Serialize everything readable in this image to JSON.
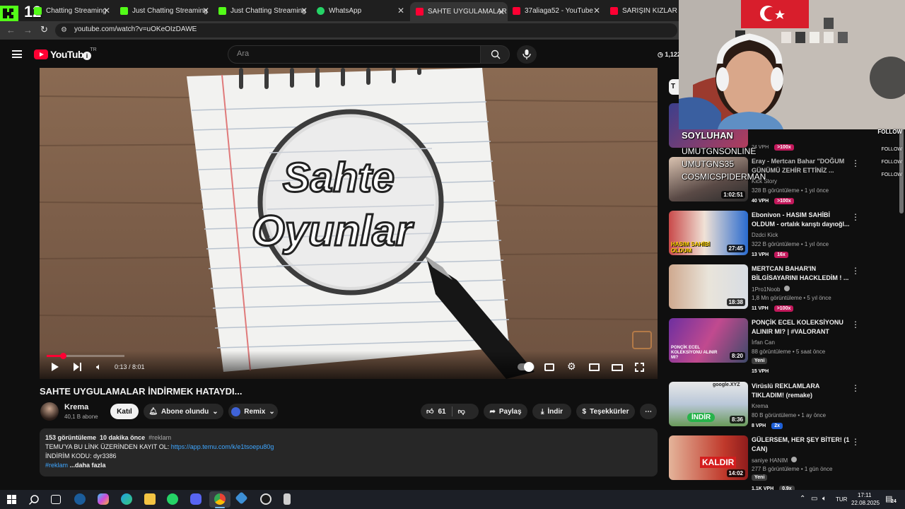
{
  "browser": {
    "tabs": [
      {
        "label": "Chatting Streaming",
        "icon": "kick-icon",
        "color": "#53fc18"
      },
      {
        "label": "Just Chatting Streaming",
        "icon": "kick-icon",
        "color": "#53fc18"
      },
      {
        "label": "Just Chatting Streaming",
        "icon": "kick-icon",
        "color": "#53fc18"
      },
      {
        "label": "WhatsApp",
        "icon": "whatsapp-icon",
        "color": "#25d366"
      },
      {
        "label": "SAHTE UYGULAMALAR İN",
        "icon": "youtube-icon",
        "color": "#ff0033"
      },
      {
        "label": "37aliaga52 - YouTube",
        "icon": "youtube-icon",
        "color": "#ff0033"
      },
      {
        "label": "SARIŞIN KIZLAR | RAP A",
        "icon": "youtube-icon",
        "color": "#ff0033"
      }
    ],
    "url": "youtube.com/watch?v=uOKeOIzDAWE"
  },
  "kick_overlay": {
    "number": "12"
  },
  "youtube": {
    "logo_text": "YouTube",
    "region": "TR",
    "search_placeholder": "Ara",
    "counter": "1,122"
  },
  "video": {
    "thumbnail_word1": "Sahte",
    "thumbnail_word2": "Oyunlar",
    "time_current": "0:13",
    "time_total": "8:01",
    "progress": 0.027,
    "title": "SAHTE UYGULAMALAR İNDİRMEK HATAYDI...",
    "channel": "Krema",
    "subscribers": "40,1 B abone",
    "join": "Katıl",
    "subscribed": "Abone olundu",
    "remix": "Remix",
    "likes": "61",
    "share": "Paylaş",
    "download": "İndir",
    "thanks": "Teşekkürler",
    "description": {
      "views": "153 görüntüleme",
      "time": "10 dakika önce",
      "tag": "#reklam",
      "line1_prefix": "TEMU'YA BU LİNK ÜZERİNDEN KAYIT OL:",
      "line1_link": "https://app.temu.com/k/e1tsoepu80g",
      "line2": "İNDİRİM KODU: dyr3386",
      "line3_tag": "#reklam",
      "more": "...daha fazla"
    }
  },
  "sidebar": {
    "filter_label": "T",
    "items": [
      {
        "title": "",
        "channel": "",
        "meta": "24 VPH",
        "duration": "",
        "vph": "",
        "badge": ">100x",
        "badge_color": "#c2185b"
      },
      {
        "title": "Eray - Mertcan Bahar \"DOĞUM GÜNÜMÜ ZEHİR ETTİNİZ ...",
        "channel": "Kick Story",
        "meta": "328 B görüntüleme • 1 yıl önce",
        "duration": "1:02:51",
        "vph": "40 VPH",
        "badge": ">100x",
        "badge_color": "#c2185b"
      },
      {
        "title": "Ebonivon - HASIM SAHİBİ OLDUM - ortalık karıştı dayıoğl...",
        "channel": "Dzdci Kick",
        "meta": "322 B görüntüleme • 1 yıl önce",
        "duration": "27:45",
        "vph": "13 VPH",
        "badge": "16x",
        "badge_color": "#c2185b"
      },
      {
        "title": "MERTCAN BAHAR'IN BİLGİSAYARINI HACKLEDİM ! ...",
        "channel": "1Pro1Noob",
        "meta": "1,8 Mn görüntüleme • 5 yıl önce",
        "duration": "18:38",
        "vph": "11 VPH",
        "badge": ">100x",
        "badge_color": "#c2185b"
      },
      {
        "title": "PONÇİK ECEL KOLEKSİYONU ALINIR MI? | #VALORANT",
        "channel": "İrfan Can",
        "meta": "88 görüntüleme • 5 saat önce",
        "duration": "8:20",
        "vph": "15 VPH",
        "badge": "Yeni",
        "badge_color": "#3f3f3f"
      },
      {
        "title": "Virüslü REKLAMLARA TIKLADIM! (remake)",
        "channel": "Krema",
        "meta": "80 B görüntüleme • 1 ay önce",
        "duration": "8:36",
        "vph": "8 VPH",
        "badge": "2x",
        "badge_color": "#1e5fd6"
      },
      {
        "title": "GÜLERSEM, HER ŞEY BİTER! (1 CAN)",
        "channel": "saniye HANIM",
        "meta": "277 B görüntüleme • 1 gün önce",
        "duration": "14:02",
        "vph": "1,1K VPH",
        "badge": "0,9x",
        "badge_color": "#3f3f3f"
      }
    ],
    "thumb_texts": {
      "hasim": "HASIM SAHİBİ OLDUM",
      "indir": "İNDİR",
      "kaldir": "KALDIR",
      "ponchik": "PONÇİK ECEL KOLEKSİYONU ALINIR MI?",
      "gsite": "google.XYZ"
    }
  },
  "stream_overlay": {
    "names": [
      "SOYLUHAN",
      "UMUTGNSONLINE",
      "UMUTGNS35",
      "COSMICSPIDERMAN"
    ],
    "follow": "FOLLOW"
  },
  "taskbar": {
    "lang": "TUR",
    "time": "17:11",
    "date": "22.08.2025",
    "notif": "24"
  }
}
